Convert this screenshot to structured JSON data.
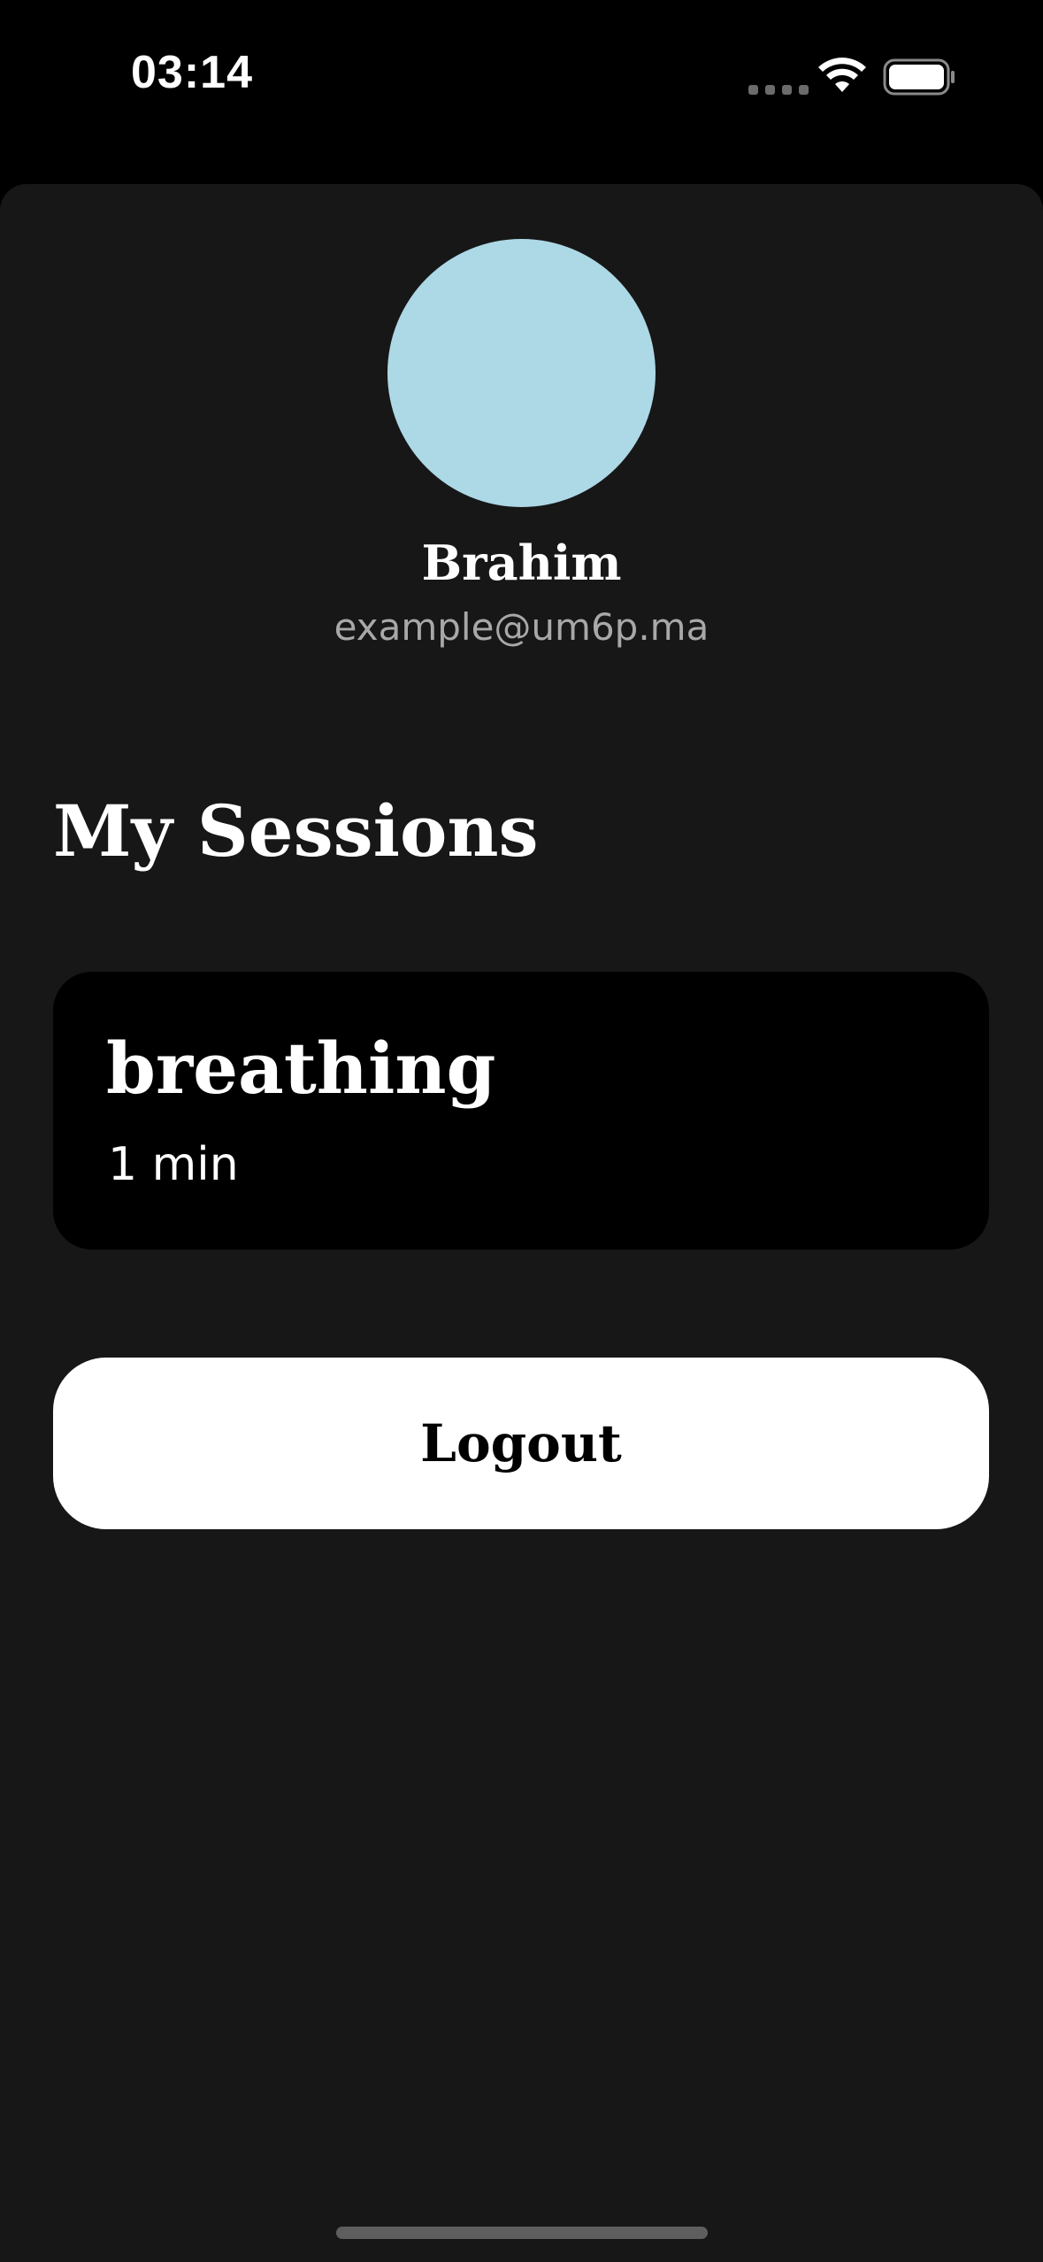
{
  "status_bar": {
    "time": "03:14",
    "icons": [
      "signal-dots-icon",
      "wifi-icon",
      "battery-icon"
    ]
  },
  "profile": {
    "name": "Brahim",
    "email": "example@um6p.ma",
    "avatar_color": "#add8e6"
  },
  "sessions": {
    "title": "My Sessions",
    "items": [
      {
        "title": "breathing",
        "duration": "1 min"
      }
    ]
  },
  "actions": {
    "logout_label": "Logout"
  },
  "colors": {
    "background": "#000000",
    "sheet": "#171717",
    "card": "#000000",
    "button": "#ffffff",
    "secondary_text": "#a8a8a8"
  }
}
